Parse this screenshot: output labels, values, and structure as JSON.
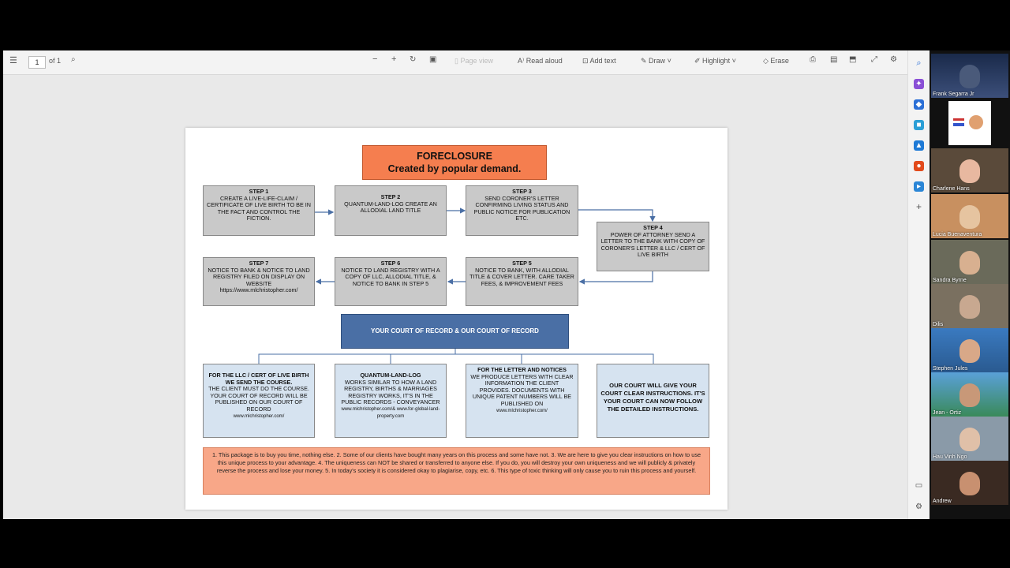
{
  "toolbar": {
    "page_current": "1",
    "page_total": "of 1",
    "page_view": "Page view",
    "read_aloud": "Read aloud",
    "add_text": "Add text",
    "draw": "Draw",
    "highlight": "Highlight",
    "erase": "Erase"
  },
  "document": {
    "title_line1": "FORECLOSURE",
    "title_line2": "Created by popular demand.",
    "steps": [
      {
        "heading": "STEP 1",
        "body": "CREATE A LIVE-LIFE-CLAIM / CERTIFICATE OF LIVE BIRTH TO BE IN THE FACT AND CONTROL THE FICTION."
      },
      {
        "heading": "STEP 2",
        "body": "QUANTUM-LAND-LOG CREATE AN ALLODIAL LAND TITLE"
      },
      {
        "heading": "STEP 3",
        "body": "SEND CORONER'S LETTER CONFIRMING LIVING STATUS AND PUBLIC NOTICE FOR PUBLICATION ETC."
      },
      {
        "heading": "STEP 4",
        "body": "POWER OF ATTORNEY SEND A LETTER TO THE BANK WITH COPY OF CORONER'S LETTER & LLC / CERT OF LIVE BIRTH"
      },
      {
        "heading": "STEP 5",
        "body": "NOTICE TO BANK, WITH ALLODIAL TITLE & COVER LETTER. CARE TAKER FEES, & IMPROVEMENT FEES"
      },
      {
        "heading": "STEP 6",
        "body": "NOTICE TO LAND REGISTRY WITH A COPY OF LLC, ALLODIAL TITLE, & NOTICE TO BANK IN STEP 5"
      },
      {
        "heading": "STEP 7",
        "body": "NOTICE TO BANK & NOTICE TO LAND REGISTRY FILED ON DISPLAY ON WEBSITE https://www.mlchristopher.com/"
      }
    ],
    "court_box": "YOUR COURT OF RECORD & OUR COURT OF RECORD",
    "bottom_boxes": [
      {
        "heading": "FOR THE LLC / CERT OF LIVE BIRTH WE SEND THE COURSE.",
        "body": "THE CLIENT MUST DO THE COURSE. YOUR COURT OF RECORD WILL BE PUBLISHED ON OUR COURT OF RECORD",
        "link": "www.mlchristopher.com/"
      },
      {
        "heading": "QUANTUM-LAND-LOG",
        "body": "WORKS SIMILAR TO HOW A LAND REGISTRY, BIRTHS & MARRIAGES REGISTRY WORKS, IT'S IN THE PUBLIC RECORDS - CONVEYANCER",
        "link": "www.mlchristopher.com/& www.for-global-land-property.com"
      },
      {
        "heading": "FOR THE LETTER AND NOTICES",
        "body": "WE PRODUCE LETTERS WITH CLEAR INFORMATION THE CLIENT PROVIDES. DOCUMENTS WITH UNIQUE PATENT NUMBERS WILL BE PUBLISHED ON",
        "link": "www.mlchristopher.com/"
      },
      {
        "heading": "OUR COURT WILL GIVE YOUR COURT CLEAR INSTRUCTIONS. IT'S YOUR COURT CAN NOW FOLLOW THE DETAILED INSTRUCTIONS.",
        "body": "",
        "link": ""
      }
    ],
    "disclaimer": "1. This package is to buy you time, nothing else. 2. Some of our clients have bought many years on this process and some have not. 3. We are here to give you clear instructions on how to use this unique process to your advantage. 4. The uniqueness can NOT be shared or transferred to anyone else. If you do, you will destroy your own uniqueness and we will publicly & privately reverse the process and lose your money. 5. In today's society it is considered okay to plagiarise, copy, etc. 6. This type of toxic thinking will only cause you to ruin this process and yourself."
  },
  "participants": [
    {
      "name": "Frank Segarra Jr"
    },
    {
      "name": ""
    },
    {
      "name": "Charlene Hans"
    },
    {
      "name": "Lucia Buenaventura"
    },
    {
      "name": "Sandra Byrne"
    },
    {
      "name": "Dilis"
    },
    {
      "name": "Stephen Jules"
    },
    {
      "name": "Jean - Ortiz"
    },
    {
      "name": "Hau Vinh Ngo"
    },
    {
      "name": "Andrew"
    }
  ],
  "colors": {
    "title_orange": "#f57e4f",
    "court_blue": "#4a6fa5",
    "disclaimer_salmon": "#f8a788",
    "arrow_blue": "#4a6fa5"
  }
}
